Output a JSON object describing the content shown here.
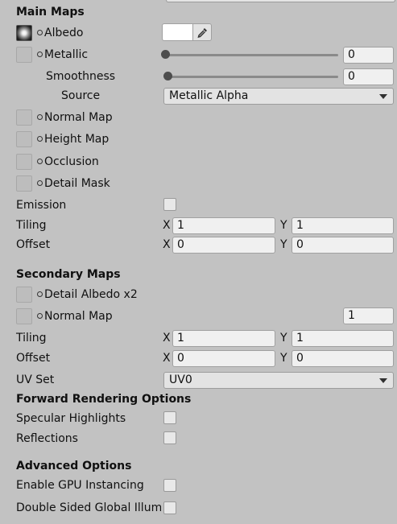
{
  "main_maps": {
    "header": "Main Maps",
    "albedo_label": "Albedo",
    "albedo_color": "#ffffff",
    "metallic_label": "Metallic",
    "metallic_value": "0",
    "metallic_slider_fraction": 0,
    "smoothness_label": "Smoothness",
    "smoothness_value": "0",
    "smoothness_slider_fraction": 0,
    "source_label": "Source",
    "source_value": "Metallic Alpha",
    "normal_map_label": "Normal Map",
    "height_map_label": "Height Map",
    "occlusion_label": "Occlusion",
    "detail_mask_label": "Detail Mask",
    "emission_label": "Emission",
    "emission_checked": false,
    "tiling_label": "Tiling",
    "tiling_x": "1",
    "tiling_y": "1",
    "offset_label": "Offset",
    "offset_x": "0",
    "offset_y": "0"
  },
  "axes": {
    "x": "X",
    "y": "Y"
  },
  "secondary_maps": {
    "header": "Secondary Maps",
    "detail_albedo_label": "Detail Albedo x2",
    "normal_map_label": "Normal Map",
    "normal_map_scale": "1",
    "tiling_label": "Tiling",
    "tiling_x": "1",
    "tiling_y": "1",
    "offset_label": "Offset",
    "offset_x": "0",
    "offset_y": "0",
    "uv_set_label": "UV Set",
    "uv_set_value": "UV0"
  },
  "forward_rendering": {
    "header": "Forward Rendering Options",
    "specular_label": "Specular Highlights",
    "specular_checked": false,
    "reflections_label": "Reflections",
    "reflections_checked": false
  },
  "advanced": {
    "header": "Advanced Options",
    "gpu_instancing_label": "Enable GPU Instancing",
    "gpu_instancing_checked": false,
    "double_sided_label": "Double Sided Global Illum",
    "double_sided_checked": false
  }
}
